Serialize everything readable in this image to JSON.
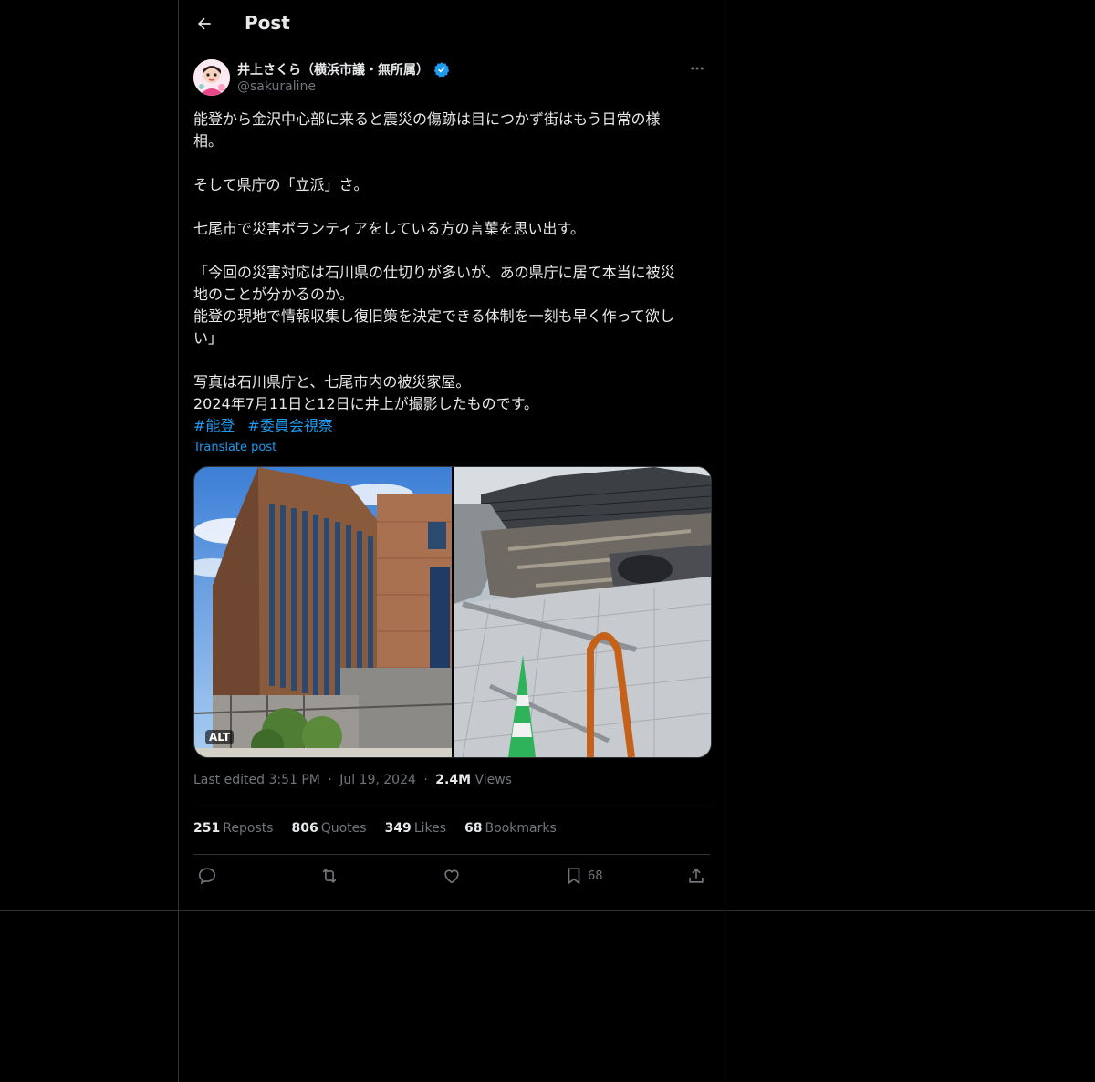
{
  "header": {
    "title": "Post"
  },
  "author": {
    "display_name": "井上さくら（横浜市議・無所属）",
    "handle": "@sakuraline"
  },
  "tweet": {
    "paragraphs": [
      "能登から金沢中心部に来ると震災の傷跡は目につかず街はもう日常の様\n相。",
      "そして県庁の「立派」さ。",
      "七尾市で災害ボランティアをしている方の言葉を思い出す。",
      "「今回の災害対応は石川県の仕切りが多いが、あの県庁に居て本当に被災\n地のことが分かるのか。\n能登の現地で情報収集し復旧策を決定できる体制を一刻も早く作って欲し\nい」",
      "写真は石川県庁と、七尾市内の被災家屋。\n2024年7月11日と12日に井上が撮影したものです。"
    ],
    "hashtags": [
      "#能登",
      "#委員会視察"
    ],
    "translate_label": "Translate post",
    "alt_badge": "ALT"
  },
  "meta": {
    "edited": "Last edited 3:51 PM",
    "sep": "·",
    "date": "Jul 19, 2024",
    "views_count": "2.4M",
    "views_label": "Views"
  },
  "stats": [
    {
      "count": "251",
      "label": "Reposts"
    },
    {
      "count": "806",
      "label": "Quotes"
    },
    {
      "count": "349",
      "label": "Likes"
    },
    {
      "count": "68",
      "label": "Bookmarks"
    }
  ],
  "actions": {
    "bookmark_count": "68"
  },
  "colors": {
    "accent": "#1d9bf0",
    "muted": "#71767b",
    "text": "#e7e9ea",
    "border": "#2f3336"
  }
}
